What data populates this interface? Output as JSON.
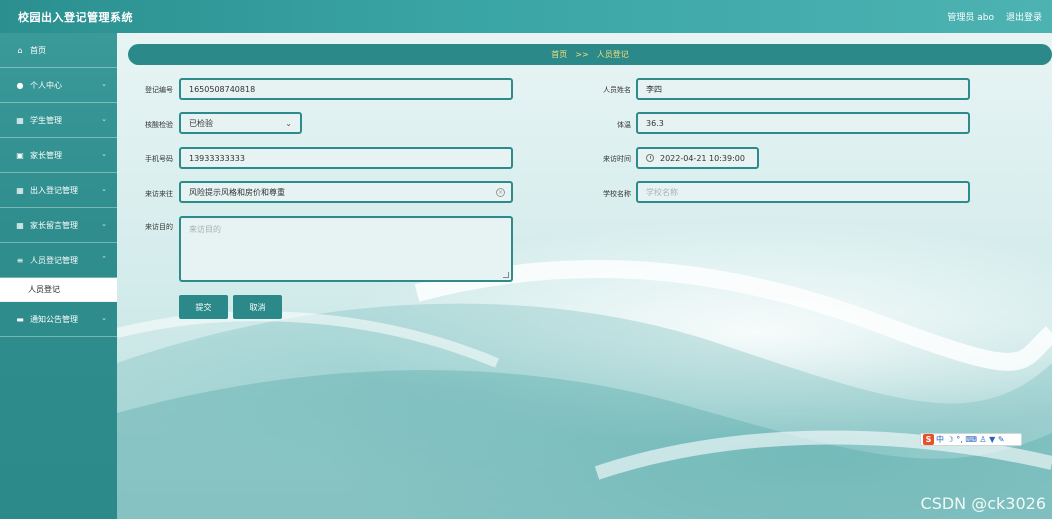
{
  "header": {
    "title": "校园出入登记管理系统",
    "user_label": "管理员 abo",
    "logout_label": "退出登录"
  },
  "sidebar": {
    "items": [
      {
        "label": "首页",
        "icon": "home-icon"
      },
      {
        "label": "个人中心",
        "icon": "user-icon"
      },
      {
        "label": "学生管理",
        "icon": "grid-icon"
      },
      {
        "label": "家长管理",
        "icon": "briefcase-icon"
      },
      {
        "label": "出入登记管理",
        "icon": "grid-icon"
      },
      {
        "label": "家长留言管理",
        "icon": "grid-icon"
      },
      {
        "label": "人员登记管理",
        "icon": "list-icon"
      },
      {
        "label": "通知公告管理",
        "icon": "keyboard-icon"
      }
    ],
    "active_sub": "人员登记"
  },
  "breadcrumb": {
    "home": "首页",
    "separator": ">>",
    "current": "人员登记"
  },
  "form": {
    "reg_no": {
      "label": "登记编号",
      "value": "1650508740818"
    },
    "person_name": {
      "label": "人员姓名",
      "value": "李四"
    },
    "health_check": {
      "label": "核酸检验",
      "value": "已检验"
    },
    "temperature": {
      "label": "体温",
      "value": "36.3"
    },
    "phone": {
      "label": "手机号码",
      "value": "13933333333"
    },
    "visit_time": {
      "label": "来访时间",
      "value": "2022-04-21 10:39:00"
    },
    "visit_from": {
      "label": "来访来往",
      "value": "风险提示风格和房价和尊重"
    },
    "school_name": {
      "label": "学校名称",
      "placeholder": "学校名称"
    },
    "visit_purpose": {
      "label": "来访目的",
      "placeholder": "来访目的"
    }
  },
  "actions": {
    "submit_label": "提交",
    "cancel_label": "取消"
  },
  "ime": {
    "logo": "S",
    "glyphs": "中 ☽ °, ⌨ ♙ ▼ ✎"
  },
  "watermark": "CSDN @ck3026",
  "colors": {
    "primary": "#2b8a89",
    "breadcrumb_text": "#f5df7d",
    "field_border": "#2d8c8b"
  }
}
